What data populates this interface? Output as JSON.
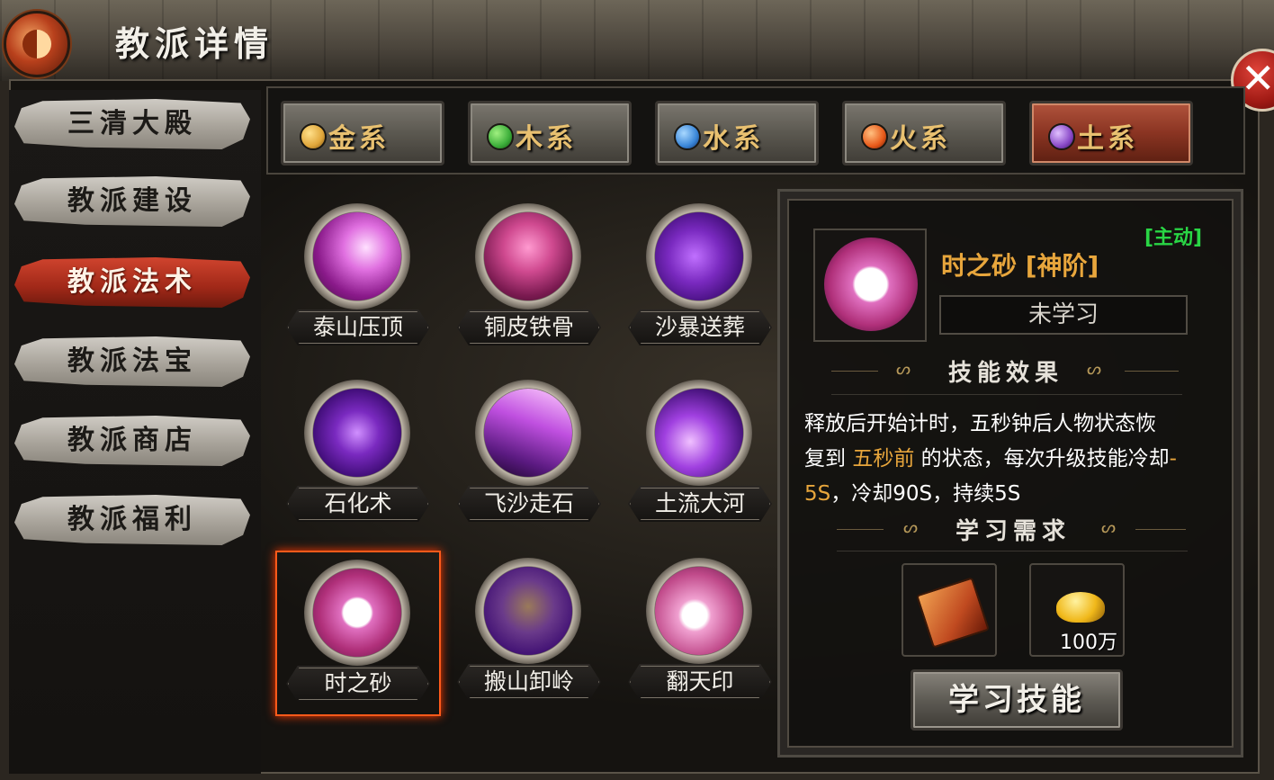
{
  "window": {
    "title": "教派详情",
    "close_symbol": "✕"
  },
  "sidebar": {
    "items": [
      {
        "label": "三清大殿",
        "active": false
      },
      {
        "label": "教派建设",
        "active": false
      },
      {
        "label": "教派法术",
        "active": true
      },
      {
        "label": "教派法宝",
        "active": false
      },
      {
        "label": "教派商店",
        "active": false
      },
      {
        "label": "教派福利",
        "active": false
      }
    ]
  },
  "tabs": [
    {
      "label": "金系",
      "icon": "gold-element-icon",
      "color": "#e0a63a",
      "active": false
    },
    {
      "label": "木系",
      "icon": "wood-element-icon",
      "color": "#3cae3a",
      "active": false
    },
    {
      "label": "水系",
      "icon": "water-element-icon",
      "color": "#3a86d8",
      "active": false
    },
    {
      "label": "火系",
      "icon": "fire-element-icon",
      "color": "#e85a1a",
      "active": false
    },
    {
      "label": "土系",
      "icon": "earth-element-icon",
      "color": "#8a4ac8",
      "active": true
    }
  ],
  "skills": [
    {
      "label": "泰山压顶",
      "icon": "mountain-crush-icon"
    },
    {
      "label": "铜皮铁骨",
      "icon": "bronze-skin-icon"
    },
    {
      "label": "沙暴送葬",
      "icon": "sandstorm-icon"
    },
    {
      "label": "石化术",
      "icon": "petrify-icon"
    },
    {
      "label": "飞沙走石",
      "icon": "flying-sand-icon"
    },
    {
      "label": "土流大河",
      "icon": "earth-river-icon"
    },
    {
      "label": "时之砂",
      "icon": "sand-of-time-icon",
      "selected": true
    },
    {
      "label": "搬山卸岭",
      "icon": "hammer-icon"
    },
    {
      "label": "翻天印",
      "icon": "seal-icon"
    }
  ],
  "detail": {
    "badge": "[主动]",
    "name": "时之砂 [神阶]",
    "status": "未学习",
    "effect_title": "技能效果",
    "description": {
      "line1": "释放后开始计时，五秒钟后人物状态恢",
      "line2_a": "复到 ",
      "line2_hl": "五秒前",
      "line2_b": " 的状态，每次升级技能冷却",
      "line2_hl2": "-",
      "line3_hl": "5S",
      "line3_b": "，冷却90S，持续5S"
    },
    "requirement_title": "学习需求",
    "requirements": [
      {
        "icon": "skill-book-icon",
        "amount": ""
      },
      {
        "icon": "gold-ingot-icon",
        "amount": "100万"
      }
    ],
    "learn_button": "学习技能"
  }
}
